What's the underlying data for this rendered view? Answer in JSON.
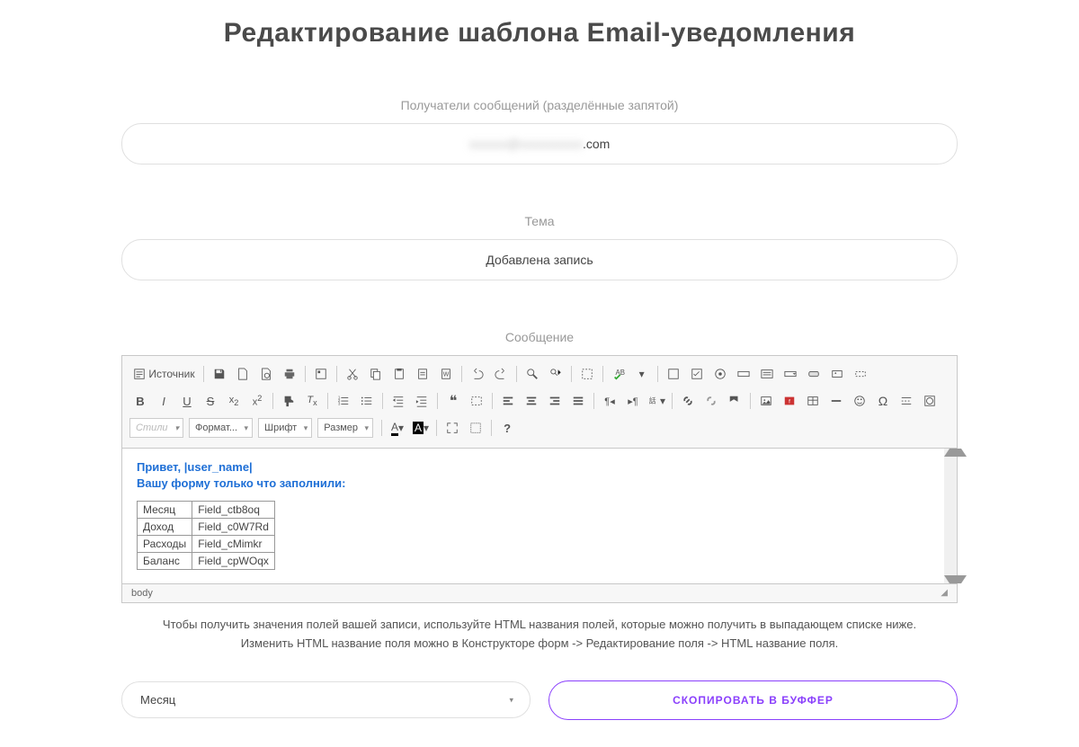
{
  "page": {
    "title": "Редактирование шаблона Email-уведомления"
  },
  "fields": {
    "recipients_label": "Получатели сообщений (разделённые запятой)",
    "recipients_value_suffix": ".com",
    "subject_label": "Тема",
    "subject_value": "Добавлена запись",
    "message_label": "Сообщение"
  },
  "toolbar": {
    "source": "Источник",
    "styles": "Стили",
    "format": "Формат...",
    "font": "Шрифт",
    "size": "Размер"
  },
  "message_body": {
    "line1": "Привет, |user_name|",
    "line2": "Вашу форму только что заполнили:",
    "table": [
      {
        "label": "Месяц",
        "value": "Field_ctb8oq"
      },
      {
        "label": "Доход",
        "value": "Field_c0W7Rd"
      },
      {
        "label": "Расходы",
        "value": "Field_cMimkr"
      },
      {
        "label": "Баланс",
        "value": "Field_cpWOqx"
      }
    ]
  },
  "status": {
    "path": "body"
  },
  "hint": {
    "line1": "Чтобы получить значения полей вашей записи, используйте HTML названия полей, которые можно получить в выпадающем списке ниже.",
    "line2": "Изменить HTML название поля можно в Конструкторе форм -> Редактирование поля -> HTML название поля."
  },
  "bottom": {
    "select_value": "Месяц",
    "copy_button": "СКОПИРОВАТЬ В БУФФЕР"
  }
}
